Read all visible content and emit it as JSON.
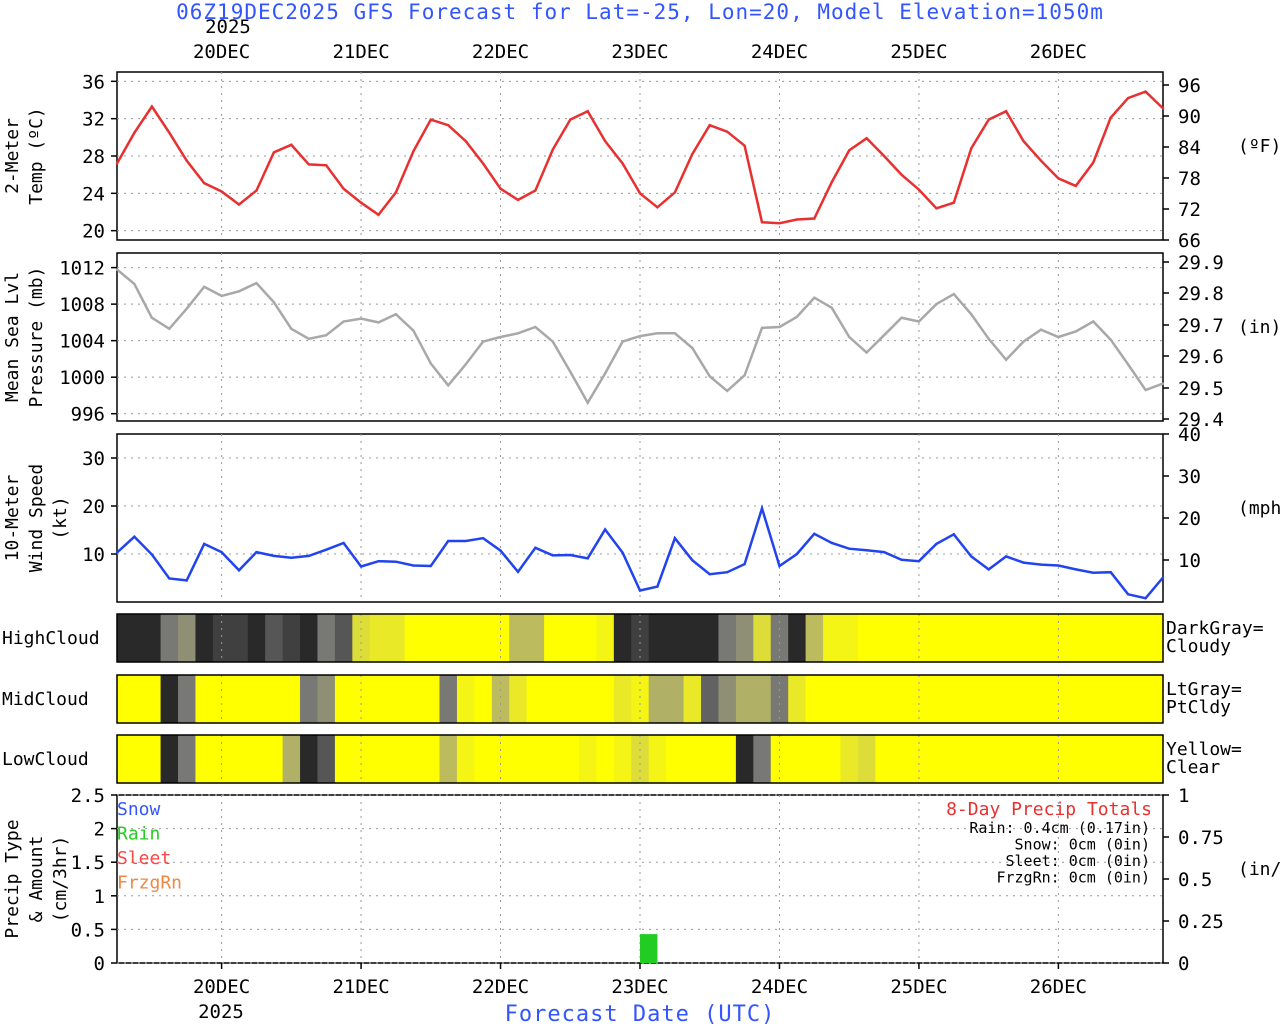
{
  "title": "06Z19DEC2025 GFS Forecast for Lat=-25, Lon=20, Model Elevation=1050m",
  "year_label": "2025",
  "date_labels": [
    "20DEC",
    "21DEC",
    "22DEC",
    "23DEC",
    "24DEC",
    "25DEC",
    "26DEC"
  ],
  "x_axis_label": "Forecast Date (UTC)",
  "colors": {
    "temp": "#e83030",
    "pressure": "#a8a8a8",
    "wind": "#2244ee",
    "rain": "#22cc22",
    "snow": "#3355ff",
    "sleet": "#ff4444",
    "frzgrn": "#ee8844",
    "title": "#3355ff"
  },
  "chart_data": [
    {
      "type": "line",
      "name": "temperature",
      "ylabel": [
        "2-Meter",
        "Temp (ºC)"
      ],
      "right_unit": "(ºF)",
      "yticks": [
        "36",
        "32",
        "28",
        "24",
        "20"
      ],
      "right_ticks": [
        "96",
        "90",
        "84",
        "78",
        "72",
        "66"
      ],
      "ylim": [
        19,
        37
      ],
      "x_hours": [
        0,
        3,
        6,
        9,
        12,
        15,
        18,
        21,
        24,
        27,
        30,
        33,
        36,
        39,
        42,
        45,
        48,
        51,
        54,
        57,
        60,
        63,
        66,
        69,
        72,
        75,
        78,
        81,
        84,
        87,
        90,
        93,
        96,
        99,
        102,
        105,
        108,
        111,
        114,
        117,
        120,
        123,
        126,
        129,
        132,
        135,
        138,
        141,
        144,
        147,
        150,
        153,
        156,
        159,
        162,
        165,
        168,
        171,
        174,
        177,
        180
      ],
      "values": [
        27.2,
        30.5,
        33.3,
        30.5,
        27.5,
        25.1,
        24.2,
        22.8,
        24.3,
        28.4,
        29.2,
        27.1,
        27.0,
        24.5,
        23.0,
        21.7,
        24.1,
        28.5,
        31.9,
        31.3,
        29.6,
        27.2,
        24.5,
        23.3,
        24.3,
        28.7,
        31.9,
        32.8,
        29.6,
        27.2,
        24.0,
        22.5,
        24.1,
        28.2,
        31.3,
        30.6,
        29.1,
        20.9,
        20.8,
        21.2,
        21.3,
        25.2,
        28.6,
        29.9,
        28.0,
        26.0,
        24.4,
        22.4,
        23.0,
        28.8,
        31.9,
        32.8,
        29.6,
        27.5,
        25.6,
        24.8,
        27.3,
        32.1,
        34.2,
        34.9,
        33.1
      ]
    },
    {
      "type": "line",
      "name": "pressure",
      "ylabel": [
        "Mean Sea Lvl",
        "Pressure (mb)"
      ],
      "right_unit": "(in)",
      "yticks": [
        "1012",
        "1008",
        "1004",
        "1000",
        "996"
      ],
      "right_ticks": [
        "29.9",
        "29.8",
        "29.7",
        "29.6",
        "29.5",
        "29.4"
      ],
      "ylim": [
        995.2,
        1013.6
      ],
      "x_hours": [
        0,
        3,
        6,
        9,
        12,
        15,
        18,
        21,
        24,
        27,
        30,
        33,
        36,
        39,
        42,
        45,
        48,
        51,
        54,
        57,
        60,
        63,
        66,
        69,
        72,
        75,
        78,
        81,
        84,
        87,
        90,
        93,
        96,
        99,
        102,
        105,
        108,
        111,
        114,
        117,
        120,
        123,
        126,
        129,
        132,
        135,
        138,
        141,
        144,
        147,
        150,
        153,
        156,
        159,
        162,
        165,
        168,
        171,
        174,
        177,
        180
      ],
      "values": [
        1011.8,
        1010.2,
        1006.5,
        1005.3,
        1007.5,
        1009.9,
        1008.9,
        1009.4,
        1010.3,
        1008.2,
        1005.3,
        1004.2,
        1004.6,
        1006.1,
        1006.4,
        1006.0,
        1006.9,
        1005.1,
        1001.5,
        999.1,
        1001.4,
        1003.9,
        1004.4,
        1004.8,
        1005.5,
        1003.9,
        1000.6,
        997.2,
        1000.4,
        1003.9,
        1004.5,
        1004.8,
        1004.8,
        1003.2,
        1000.1,
        998.5,
        1000.2,
        1005.4,
        1005.5,
        1006.6,
        1008.7,
        1007.6,
        1004.4,
        1002.7,
        1004.6,
        1006.5,
        1006.1,
        1008.0,
        1009.1,
        1006.9,
        1004.2,
        1001.9,
        1003.9,
        1005.2,
        1004.4,
        1005.0,
        1006.1,
        1004.1,
        1001.4,
        998.6,
        999.3
      ]
    },
    {
      "type": "line",
      "name": "wind",
      "ylabel": [
        "10-Meter",
        "Wind Speed",
        "(kt)"
      ],
      "right_unit": "(mph)",
      "yticks": [
        "30",
        "20",
        "10"
      ],
      "right_ticks": [
        "40",
        "30",
        "20",
        "10"
      ],
      "ylim": [
        0,
        35
      ],
      "x_hours": [
        0,
        3,
        6,
        9,
        12,
        15,
        18,
        21,
        24,
        27,
        30,
        33,
        36,
        39,
        42,
        45,
        48,
        51,
        54,
        57,
        60,
        63,
        66,
        69,
        72,
        75,
        78,
        81,
        84,
        87,
        90,
        93,
        96,
        99,
        102,
        105,
        108,
        111,
        114,
        117,
        120,
        123,
        126,
        129,
        132,
        135,
        138,
        141,
        144,
        147,
        150,
        153,
        156,
        159,
        162,
        165,
        168,
        171,
        174,
        177,
        180
      ],
      "values": [
        10.3,
        13.6,
        9.9,
        4.9,
        4.5,
        12.1,
        10.4,
        6.6,
        10.4,
        9.6,
        9.2,
        9.6,
        10.9,
        12.3,
        7.4,
        8.5,
        8.4,
        7.6,
        7.5,
        12.7,
        12.7,
        13.3,
        10.7,
        6.3,
        11.3,
        9.7,
        9.8,
        9.1,
        15.1,
        10.3,
        2.4,
        3.2,
        13.3,
        8.7,
        5.8,
        6.2,
        7.9,
        19.5,
        7.5,
        10.0,
        14.2,
        12.3,
        11.1,
        10.8,
        10.4,
        8.8,
        8.5,
        12.1,
        14.1,
        9.5,
        6.8,
        9.5,
        8.2,
        7.8,
        7.6,
        6.8,
        6.1,
        6.2,
        1.6,
        0.8,
        5.1
      ]
    },
    {
      "type": "heatmap",
      "name": "clouds",
      "rows": [
        {
          "label": "HighCloud",
          "legend": [
            "DarkGray=",
            "Cloudy"
          ],
          "values": [
            0.95,
            0.95,
            0.95,
            0.6,
            0.5,
            0.95,
            0.85,
            0.85,
            0.95,
            0.75,
            0.85,
            0.95,
            0.6,
            0.75,
            0.15,
            0.1,
            0.1,
            0,
            0,
            0,
            0,
            0,
            0,
            0.3,
            0.3,
            0,
            0,
            0,
            0.05,
            0.95,
            0.85,
            0.95,
            0.95,
            0.95,
            0.95,
            0.6,
            0.5,
            0.15,
            0.6,
            0.95,
            0.3,
            0.05,
            0.05,
            0,
            0,
            0,
            0,
            0,
            0,
            0,
            0,
            0,
            0,
            0,
            0,
            0,
            0,
            0,
            0,
            0,
            0
          ]
        },
        {
          "label": "MidCloud",
          "legend": [
            "LtGray=",
            "PtCldy"
          ],
          "values": [
            0,
            0,
            0,
            0.95,
            0.6,
            0,
            0,
            0,
            0,
            0,
            0,
            0.6,
            0.5,
            0,
            0,
            0,
            0,
            0,
            0,
            0.6,
            0.05,
            0,
            0.3,
            0.1,
            0,
            0,
            0,
            0,
            0,
            0.1,
            0.05,
            0.35,
            0.35,
            0.1,
            0.7,
            0.5,
            0.35,
            0.35,
            0.6,
            0.1,
            0,
            0,
            0,
            0,
            0,
            0,
            0,
            0,
            0,
            0,
            0,
            0,
            0,
            0,
            0,
            0,
            0,
            0,
            0,
            0,
            0
          ]
        },
        {
          "label": "LowCloud",
          "legend": [
            "Yellow=",
            "Clear"
          ],
          "values": [
            0,
            0,
            0,
            0.95,
            0.6,
            0,
            0,
            0,
            0,
            0,
            0.35,
            0.95,
            0.75,
            0,
            0,
            0,
            0,
            0,
            0,
            0.3,
            0.05,
            0,
            0,
            0,
            0,
            0,
            0,
            0.05,
            0,
            0.05,
            0.15,
            0.05,
            0,
            0,
            0,
            0,
            0.95,
            0.6,
            0,
            0,
            0,
            0,
            0.1,
            0.15,
            0,
            0,
            0,
            0,
            0,
            0,
            0,
            0,
            0,
            0,
            0,
            0,
            0,
            0,
            0,
            0,
            0
          ]
        }
      ]
    },
    {
      "type": "bar",
      "name": "precipitation",
      "ylabel": [
        "Precip Type",
        "& Amount",
        "(cm/3hr)"
      ],
      "right_unit": "(in/3hr)",
      "yticks": [
        "2.5",
        "2",
        "1.5",
        "1",
        "0.5",
        "0"
      ],
      "right_ticks": [
        "1",
        "0.75",
        "0.5",
        "0.25",
        "0"
      ],
      "ylim": [
        0,
        2.5
      ],
      "legend": [
        "Snow",
        "Rain",
        "Sleet",
        "FrzgRn"
      ],
      "bars": [
        {
          "start_hour": 90,
          "end_hour": 93,
          "type": "Rain",
          "value": 0.43
        }
      ],
      "totals_title": "8-Day Precip Totals",
      "totals": [
        "Rain: 0.4cm (0.17in)",
        "Snow: 0cm (0in)",
        "Sleet: 0cm (0in)",
        "FrzgRn: 0cm (0in)"
      ]
    }
  ]
}
